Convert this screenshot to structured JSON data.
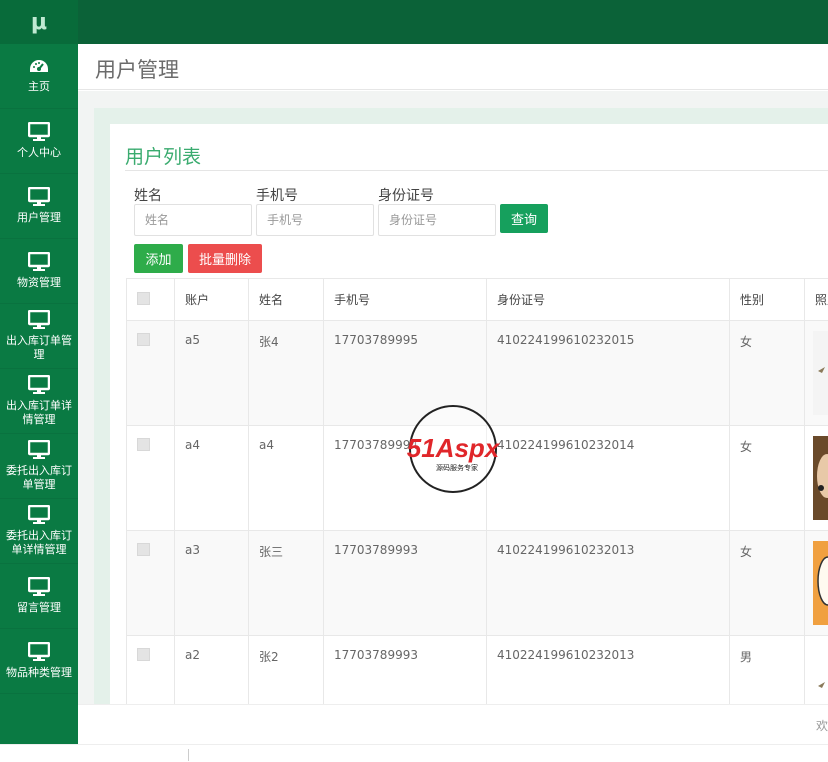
{
  "app": {
    "logo": "μ"
  },
  "sidebar": {
    "items": [
      {
        "label": "主页",
        "icon": "dashboard-icon"
      },
      {
        "label": "个人中心",
        "icon": "monitor-icon"
      },
      {
        "label": "用户管理",
        "icon": "monitor-icon"
      },
      {
        "label": "物资管理",
        "icon": "monitor-icon"
      },
      {
        "label": "出入库订单管理",
        "icon": "monitor-icon"
      },
      {
        "label": "出入库订单详情管理",
        "icon": "monitor-icon"
      },
      {
        "label": "委托出入库订单管理",
        "icon": "monitor-icon"
      },
      {
        "label": "委托出入库订单详情管理",
        "icon": "monitor-icon"
      },
      {
        "label": "留言管理",
        "icon": "monitor-icon"
      },
      {
        "label": "物品种类管理",
        "icon": "monitor-icon"
      }
    ]
  },
  "header": {
    "title": "用户管理"
  },
  "card": {
    "title": "用户列表"
  },
  "search": {
    "name_label": "姓名",
    "name_placeholder": "姓名",
    "phone_label": "手机号",
    "phone_placeholder": "手机号",
    "id_label": "身份证号",
    "id_placeholder": "身份证号",
    "query_label": "查询"
  },
  "actions": {
    "add_label": "添加",
    "batch_delete_label": "批量删除"
  },
  "table": {
    "columns": [
      "账户",
      "姓名",
      "手机号",
      "身份证号",
      "性别",
      "照片"
    ],
    "rows": [
      {
        "account": "a5",
        "name": "张4",
        "phone": "17703789995",
        "id_number": "410224199610232015",
        "gender": "女"
      },
      {
        "account": "a4",
        "name": "a4",
        "phone": "17703789994",
        "id_number": "410224199610232014",
        "gender": "女"
      },
      {
        "account": "a3",
        "name": "张三",
        "phone": "17703789993",
        "id_number": "410224199610232013",
        "gender": "女"
      },
      {
        "account": "a2",
        "name": "张2",
        "phone": "17703789993",
        "id_number": "410224199610232013",
        "gender": "男"
      }
    ]
  },
  "footer": {
    "text": "欢"
  },
  "watermark": {
    "brand": "51Aspx",
    "tagline": "源码服务专家"
  },
  "colors": {
    "sidebar": "#0a7a43",
    "topbar": "#0b6238",
    "accent": "#3aab6f",
    "danger": "#ec4d4d",
    "success": "#2eac4a"
  }
}
